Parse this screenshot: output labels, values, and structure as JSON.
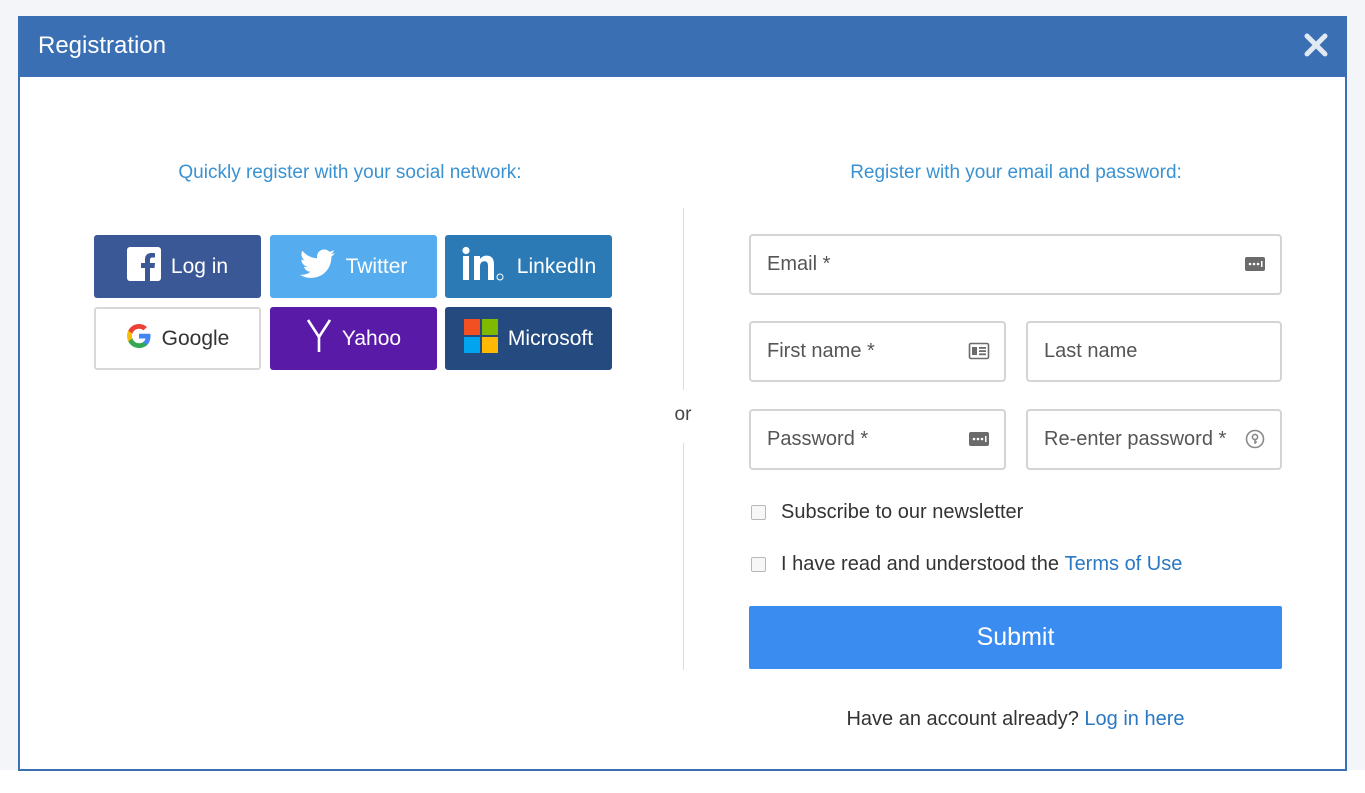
{
  "modal": {
    "title": "Registration",
    "header_color": "#3a6fb4"
  },
  "social": {
    "heading": "Quickly register with your social network:",
    "buttons": [
      {
        "label": "Log in",
        "icon": "facebook-icon",
        "color": "#3b5896"
      },
      {
        "label": "Twitter",
        "icon": "twitter-icon",
        "color": "#55acee"
      },
      {
        "label": "LinkedIn",
        "icon": "linkedin-icon",
        "color": "#2b7ab5"
      },
      {
        "label": "Google",
        "icon": "google-icon",
        "color": "#ffffff"
      },
      {
        "label": "Yahoo",
        "icon": "yahoo-icon",
        "color": "#5a1aa8"
      },
      {
        "label": "Microsoft",
        "icon": "microsoft-icon",
        "color": "#254a80"
      }
    ]
  },
  "separator": {
    "label": "or"
  },
  "form": {
    "heading": "Register with your email and password:",
    "fields": {
      "email": {
        "placeholder": "Email *",
        "value": ""
      },
      "first_name": {
        "placeholder": "First name *",
        "value": ""
      },
      "last_name": {
        "placeholder": "Last name",
        "value": ""
      },
      "password": {
        "placeholder": "Password *",
        "value": ""
      },
      "reenter_password": {
        "placeholder": "Re-enter password *",
        "value": ""
      }
    },
    "newsletter_label": "Subscribe to our newsletter",
    "terms_prefix": "I have read and understood the",
    "terms_link": "Terms of Use",
    "submit_label": "Submit",
    "submit_color": "#3b8cf1",
    "account_prompt": "Have an account already?",
    "login_link": "Log in here"
  }
}
